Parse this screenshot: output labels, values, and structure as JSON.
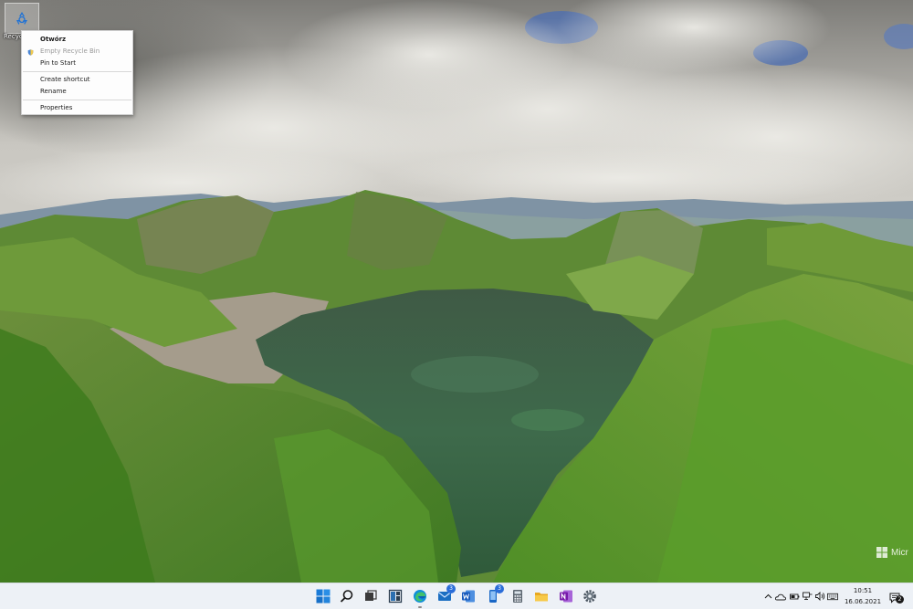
{
  "desktop": {
    "recycle_bin_label": "Recyc"
  },
  "context_menu": {
    "items": [
      {
        "label": "Otwórz",
        "bold": true
      },
      {
        "label": "Empty Recycle Bin",
        "disabled": true,
        "icon": "shield-icon"
      },
      {
        "label": "Pin to Start"
      },
      {
        "label": "Create shortcut"
      },
      {
        "label": "Rename"
      },
      {
        "label": "Properties"
      }
    ]
  },
  "watermark": {
    "text": "Micr"
  },
  "taskbar": {
    "apps": [
      {
        "name": "start-icon"
      },
      {
        "name": "search-icon"
      },
      {
        "name": "task-view-icon"
      },
      {
        "name": "widgets-icon"
      },
      {
        "name": "edge-icon",
        "running": true
      },
      {
        "name": "mail-icon",
        "badge": "3"
      },
      {
        "name": "word-icon"
      },
      {
        "name": "phone-icon",
        "badge": "3"
      },
      {
        "name": "calculator-icon"
      },
      {
        "name": "file-explorer-icon"
      },
      {
        "name": "onenote-icon"
      },
      {
        "name": "settings-icon"
      }
    ],
    "tray": [
      "chevron-up-icon",
      "onedrive-icon",
      "battery-icon",
      "network-icon",
      "volume-icon",
      "keyboard-icon"
    ],
    "clock": {
      "time": "10:51",
      "date": "16.06.2021"
    },
    "notifications": {
      "count": "2"
    }
  },
  "colors": {
    "taskbar_bg": "#edf1f6",
    "accent": "#2b6dd9"
  }
}
